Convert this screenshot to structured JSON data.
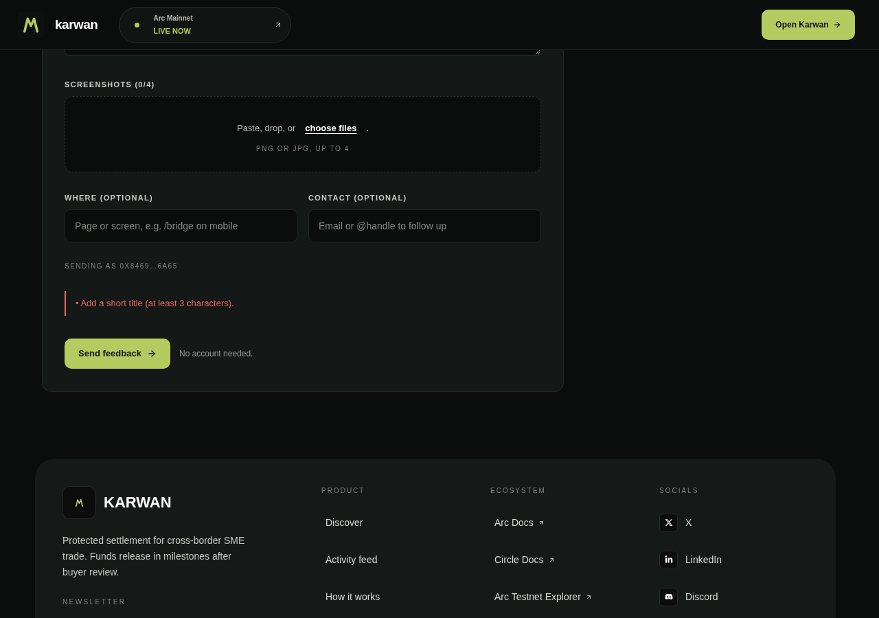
{
  "header": {
    "brand": "karwan",
    "network": {
      "name": "Arc Mainnet",
      "status": "LIVE NOW"
    },
    "cta": "Open Karwan"
  },
  "form": {
    "screenshots": {
      "label": "SCREENSHOTS (0/4)",
      "prompt": "Paste, drop, or",
      "link": "choose files",
      "suffix": ".",
      "hint": "PNG OR JPG, UP TO 4"
    },
    "fields": [
      {
        "label": "WHERE (OPTIONAL)",
        "placeholder": "Page or screen, e.g. /bridge on mobile"
      },
      {
        "label": "CONTACT (OPTIONAL)",
        "placeholder": "Email or @handle to follow up"
      }
    ],
    "sender": "SENDING AS 0X8469…6A65",
    "errors": [
      "• Add a short title (at least 3 characters)."
    ],
    "submit": "Send feedback",
    "note": "No account needed."
  },
  "footer": {
    "brand": "KARWAN",
    "tagline": "Protected settlement for cross-border SME trade. Funds release in milestones after buyer review.",
    "newsletter_label": "NEWSLETTER",
    "columns": [
      {
        "heading": "PRODUCT",
        "links": [
          {
            "label": "Discover",
            "kind": "internal"
          },
          {
            "label": "Activity feed",
            "kind": "internal"
          },
          {
            "label": "How it works",
            "kind": "internal"
          }
        ]
      },
      {
        "heading": "ECOSYSTEM",
        "links": [
          {
            "label": "Arc Docs",
            "kind": "external"
          },
          {
            "label": "Circle Docs",
            "kind": "external"
          },
          {
            "label": "Arc Testnet Explorer",
            "kind": "external"
          }
        ]
      },
      {
        "heading": "SOCIALS",
        "links": [
          {
            "label": "X",
            "kind": "x"
          },
          {
            "label": "LinkedIn",
            "kind": "linkedin"
          },
          {
            "label": "Discord",
            "kind": "discord"
          }
        ]
      }
    ]
  }
}
